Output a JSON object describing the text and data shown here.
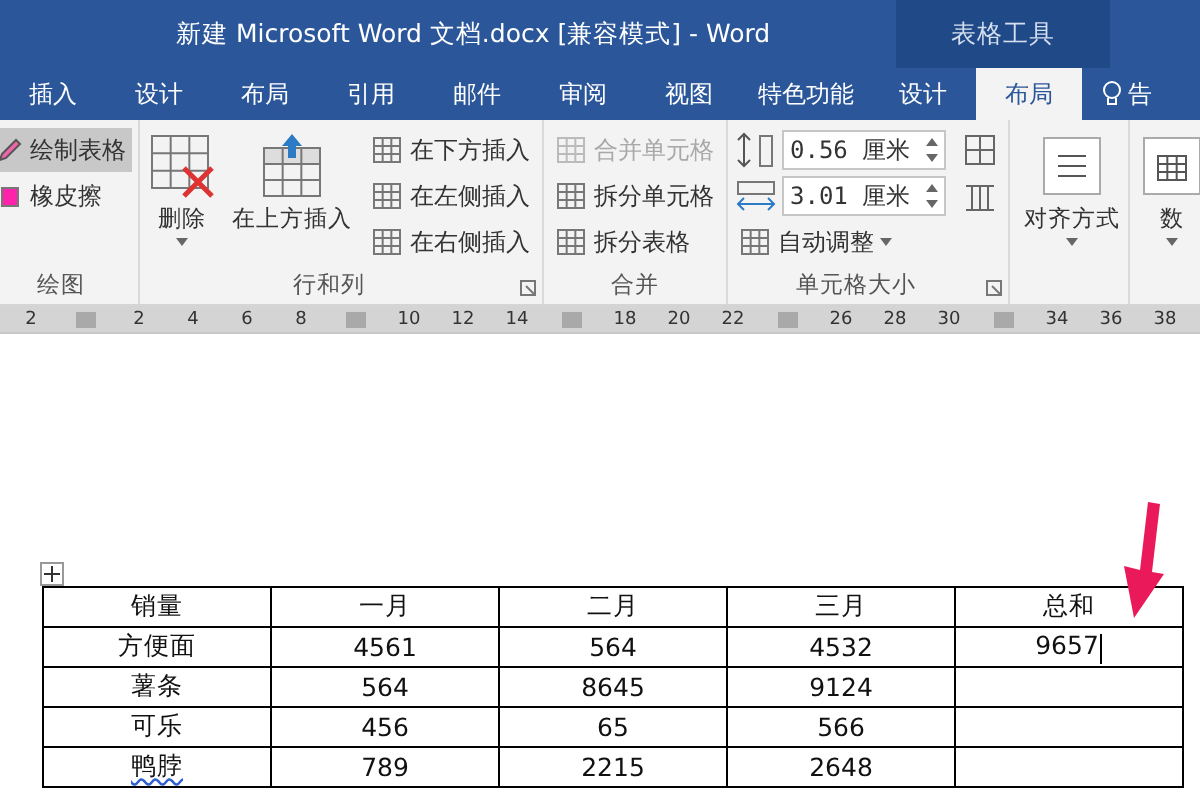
{
  "window": {
    "title": "新建 Microsoft Word 文档.docx [兼容模式] - Word",
    "context_group": "表格工具"
  },
  "tabs": [
    {
      "label": "插入",
      "selected": false
    },
    {
      "label": "设计",
      "selected": false
    },
    {
      "label": "布局",
      "selected": false
    },
    {
      "label": "引用",
      "selected": false
    },
    {
      "label": "邮件",
      "selected": false
    },
    {
      "label": "审阅",
      "selected": false
    },
    {
      "label": "视图",
      "selected": false
    },
    {
      "label": "特色功能",
      "selected": false
    },
    {
      "label": "设计",
      "selected": false
    },
    {
      "label": "布局",
      "selected": true
    }
  ],
  "tell_me": "告",
  "ribbon": [
    {
      "label": "绘图",
      "columns": [
        [
          {
            "kind": "small",
            "label": "绘制表格",
            "selected": true,
            "disabled": false
          },
          {
            "kind": "small",
            "label": "橡皮擦",
            "selected": false,
            "disabled": false
          }
        ]
      ]
    },
    {
      "label": "行和列",
      "launcher": true,
      "columns": [
        [
          {
            "kind": "large",
            "label": "删除",
            "dropdown": true
          }
        ],
        [
          {
            "kind": "large",
            "label": "在上方插入"
          }
        ],
        [
          {
            "kind": "small",
            "label": "在下方插入",
            "selected": false,
            "disabled": false
          },
          {
            "kind": "small",
            "label": "在左侧插入",
            "selected": false,
            "disabled": false
          },
          {
            "kind": "small",
            "label": "在右侧插入",
            "selected": false,
            "disabled": false
          }
        ]
      ]
    },
    {
      "label": "合并",
      "columns": [
        [
          {
            "kind": "small",
            "label": "合并单元格",
            "selected": false,
            "disabled": true
          },
          {
            "kind": "small",
            "label": "拆分单元格",
            "selected": false,
            "disabled": false
          },
          {
            "kind": "small",
            "label": "拆分表格",
            "selected": false,
            "disabled": false
          }
        ]
      ]
    },
    {
      "label": "单元格大小",
      "launcher": true,
      "columns": [
        [
          {
            "kind": "spin",
            "value": "0.56 厘米"
          },
          {
            "kind": "spin",
            "value": "3.01 厘米"
          },
          {
            "kind": "small",
            "label": "自动调整",
            "selected": false,
            "disabled": false,
            "dropdown": true
          }
        ],
        [
          {
            "kind": "icon"
          },
          {
            "kind": "icon"
          }
        ]
      ]
    },
    {
      "columns": [
        [
          {
            "kind": "large",
            "label": "对齐方式",
            "dropdown": true
          }
        ]
      ]
    },
    {
      "columns": [
        [
          {
            "kind": "large",
            "label": "数",
            "dropdown": true
          }
        ]
      ]
    }
  ],
  "ruler": [
    {
      "kind": "label",
      "text": "2"
    },
    {
      "kind": "marker"
    },
    {
      "kind": "label",
      "text": "2"
    },
    {
      "kind": "label",
      "text": "4"
    },
    {
      "kind": "label",
      "text": "6"
    },
    {
      "kind": "label",
      "text": "8"
    },
    {
      "kind": "marker"
    },
    {
      "kind": "label",
      "text": "10"
    },
    {
      "kind": "label",
      "text": "12"
    },
    {
      "kind": "label",
      "text": "14"
    },
    {
      "kind": "marker"
    },
    {
      "kind": "label",
      "text": "18"
    },
    {
      "kind": "label",
      "text": "20"
    },
    {
      "kind": "label",
      "text": "22"
    },
    {
      "kind": "marker"
    },
    {
      "kind": "label",
      "text": "26"
    },
    {
      "kind": "label",
      "text": "28"
    },
    {
      "kind": "label",
      "text": "30"
    },
    {
      "kind": "marker"
    },
    {
      "kind": "label",
      "text": "34"
    },
    {
      "kind": "label",
      "text": "36"
    },
    {
      "kind": "label",
      "text": "38"
    }
  ],
  "table": {
    "columns": [
      "销量",
      "一月",
      "二月",
      "三月",
      "总和"
    ],
    "rows": [
      {
        "cells": [
          "方便面",
          "4561",
          "564",
          "4532",
          "9657"
        ],
        "caret": true,
        "misspelled": false
      },
      {
        "cells": [
          "薯条",
          "564",
          "8645",
          "9124"
        ],
        "caret": false,
        "misspelled": false
      },
      {
        "cells": [
          "可乐",
          "456",
          "65",
          "566"
        ],
        "caret": false,
        "misspelled": false
      },
      {
        "cells": [
          "鸭脖",
          "789",
          "2215",
          "2648"
        ],
        "caret": false,
        "misspelled": true
      }
    ]
  }
}
